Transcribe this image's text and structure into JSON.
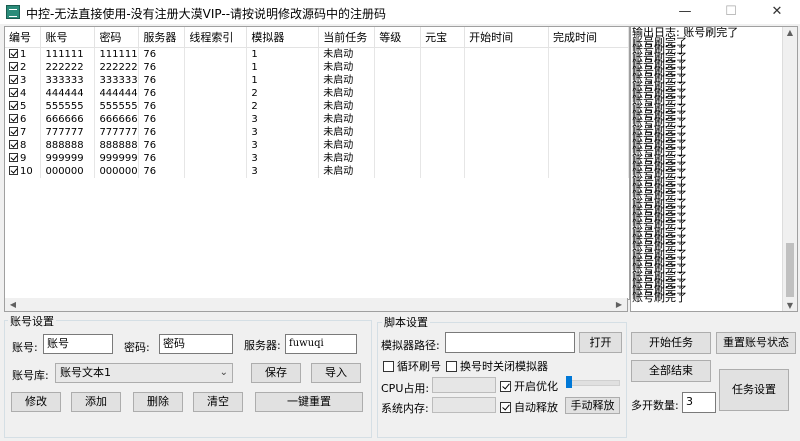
{
  "window": {
    "title": "中控-无法直接使用-没有注册大漠VIP--请按说明修改源码中的注册码",
    "minimize": "—",
    "maximize": "☐",
    "close": "✕"
  },
  "grid": {
    "columns": [
      "编号",
      "账号",
      "密码",
      "服务器",
      "线程索引",
      "模拟器",
      "当前任务",
      "等级",
      "元宝",
      "开始时间",
      "完成时间"
    ],
    "rows": [
      {
        "checked": true,
        "no": "1",
        "account": "111111",
        "password": "111111",
        "server": "76",
        "thread": "",
        "emulator": "1",
        "task": "未启动"
      },
      {
        "checked": true,
        "no": "2",
        "account": "222222",
        "password": "222222",
        "server": "76",
        "thread": "",
        "emulator": "1",
        "task": "未启动"
      },
      {
        "checked": true,
        "no": "3",
        "account": "333333",
        "password": "333333",
        "server": "76",
        "thread": "",
        "emulator": "1",
        "task": "未启动"
      },
      {
        "checked": true,
        "no": "4",
        "account": "444444",
        "password": "444444",
        "server": "76",
        "thread": "",
        "emulator": "2",
        "task": "未启动"
      },
      {
        "checked": true,
        "no": "5",
        "account": "555555",
        "password": "555555",
        "server": "76",
        "thread": "",
        "emulator": "2",
        "task": "未启动"
      },
      {
        "checked": true,
        "no": "6",
        "account": "666666",
        "password": "666666",
        "server": "76",
        "thread": "",
        "emulator": "3",
        "task": "未启动"
      },
      {
        "checked": true,
        "no": "7",
        "account": "777777",
        "password": "777777",
        "server": "76",
        "thread": "",
        "emulator": "3",
        "task": "未启动"
      },
      {
        "checked": true,
        "no": "8",
        "account": "888888",
        "password": "888888",
        "server": "76",
        "thread": "",
        "emulator": "3",
        "task": "未启动"
      },
      {
        "checked": true,
        "no": "9",
        "account": "999999",
        "password": "999999",
        "server": "76",
        "thread": "",
        "emulator": "3",
        "task": "未启动"
      },
      {
        "checked": true,
        "no": "10",
        "account": "000000",
        "password": "000000",
        "server": "76",
        "thread": "",
        "emulator": "3",
        "task": "未启动"
      }
    ]
  },
  "log": {
    "header": "输出日志: 账号刷完了",
    "line": "账号刷完了",
    "line_count": 36
  },
  "account_settings": {
    "legend": "账号设置",
    "account_label": "账号:",
    "account_value": "账号",
    "password_label": "密码:",
    "password_value": "密码",
    "server_label": "服务器:",
    "server_value": "fuwuqi",
    "library_label": "账号库:",
    "library_value": "账号文本1",
    "save": "保存",
    "import": "导入",
    "modify": "修改",
    "add": "添加",
    "delete": "删除",
    "clear": "清空",
    "reset": "一键重置"
  },
  "script_settings": {
    "legend": "脚本设置",
    "emulator_path_label": "模拟器路径:",
    "emulator_path_value": "",
    "open": "打开",
    "loop_account": "循环刷号",
    "close_emulator_on_switch": "换号时关闭模拟器",
    "cpu_label": "CPU占用:",
    "memory_label": "系统内存:",
    "optimize": "开启优化",
    "auto_release": "自动释放",
    "manual_release": "手动释放"
  },
  "task_controls": {
    "start": "开始任务",
    "reset_status": "重置账号状态",
    "end_all": "全部结束",
    "task_settings": "任务设置",
    "multi_count_label": "多开数量:",
    "multi_count_value": "3"
  },
  "colors": {
    "accent": "#0078d7",
    "window_bg": "#f0f0f0"
  }
}
